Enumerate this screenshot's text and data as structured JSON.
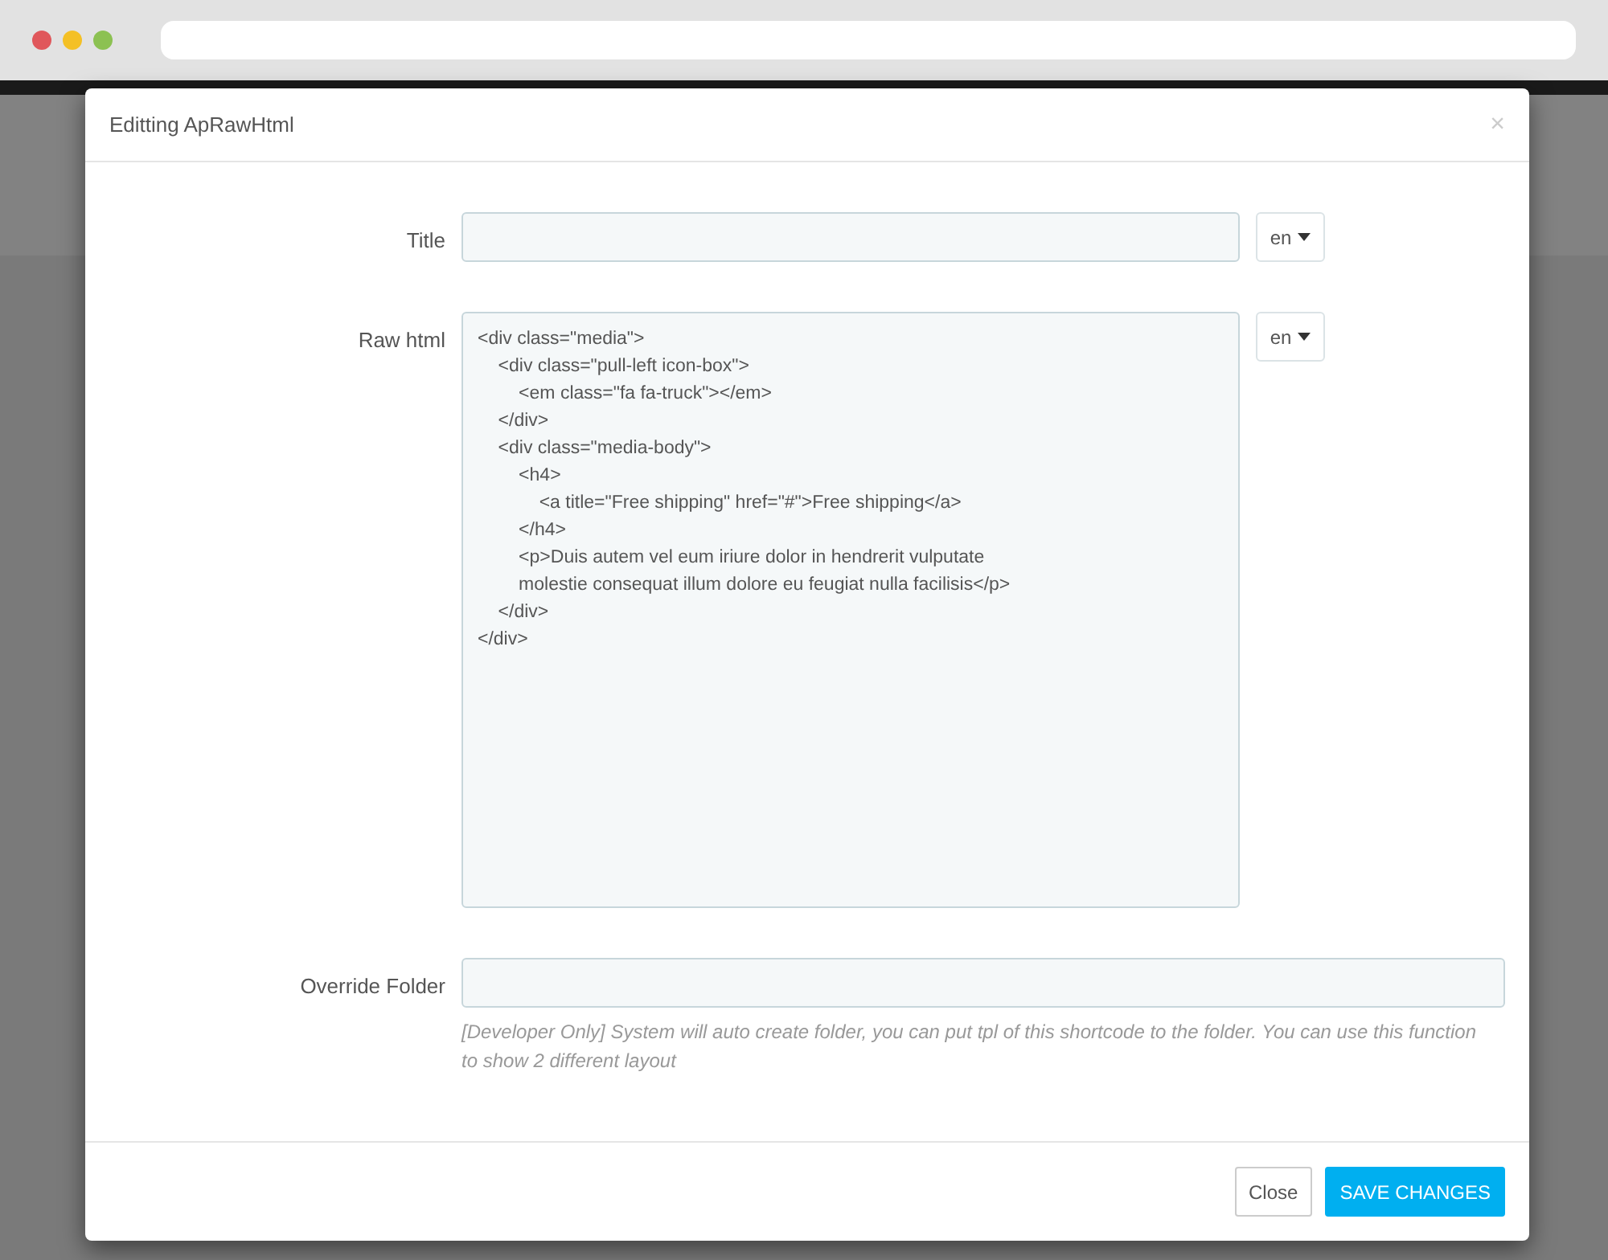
{
  "modal": {
    "title": "Editting ApRawHtml",
    "close_symbol": "×"
  },
  "fields": [
    {
      "kind": "input",
      "label": "Title",
      "language": "en"
    },
    {
      "kind": "textarea",
      "label": "Raw html",
      "value": "<div class=\"media\">\n    <div class=\"pull-left icon-box\">\n        <em class=\"fa fa-truck\"></em>\n    </div>\n    <div class=\"media-body\">\n        <h4>\n            <a title=\"Free shipping\" href=\"#\">Free shipping</a>\n        </h4>\n        <p>Duis autem vel eum iriure dolor in hendrerit vulputate\n        molestie consequat illum dolore eu feugiat nulla facilisis</p>\n    </div>\n</div>",
      "language": "en"
    },
    {
      "kind": "input",
      "label": "Override Folder",
      "help": "[Developer Only] System will auto create folder, you can put tpl of this shortcode to the folder. You can use this function to show 2 different layout"
    }
  ],
  "buttons": [
    {
      "kind": "default",
      "label": "Close"
    },
    {
      "kind": "primary",
      "label": "SAVE CHANGES"
    }
  ]
}
